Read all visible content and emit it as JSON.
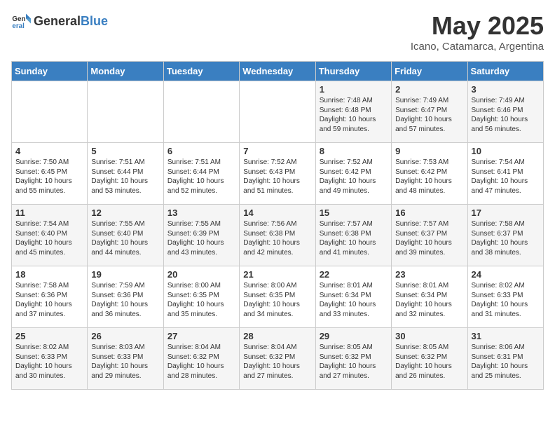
{
  "header": {
    "logo_general": "General",
    "logo_blue": "Blue",
    "month_title": "May 2025",
    "subtitle": "Icano, Catamarca, Argentina"
  },
  "days_of_week": [
    "Sunday",
    "Monday",
    "Tuesday",
    "Wednesday",
    "Thursday",
    "Friday",
    "Saturday"
  ],
  "weeks": [
    [
      {
        "day": "",
        "info": ""
      },
      {
        "day": "",
        "info": ""
      },
      {
        "day": "",
        "info": ""
      },
      {
        "day": "",
        "info": ""
      },
      {
        "day": "1",
        "info": "Sunrise: 7:48 AM\nSunset: 6:48 PM\nDaylight: 10 hours\nand 59 minutes."
      },
      {
        "day": "2",
        "info": "Sunrise: 7:49 AM\nSunset: 6:47 PM\nDaylight: 10 hours\nand 57 minutes."
      },
      {
        "day": "3",
        "info": "Sunrise: 7:49 AM\nSunset: 6:46 PM\nDaylight: 10 hours\nand 56 minutes."
      }
    ],
    [
      {
        "day": "4",
        "info": "Sunrise: 7:50 AM\nSunset: 6:45 PM\nDaylight: 10 hours\nand 55 minutes."
      },
      {
        "day": "5",
        "info": "Sunrise: 7:51 AM\nSunset: 6:44 PM\nDaylight: 10 hours\nand 53 minutes."
      },
      {
        "day": "6",
        "info": "Sunrise: 7:51 AM\nSunset: 6:44 PM\nDaylight: 10 hours\nand 52 minutes."
      },
      {
        "day": "7",
        "info": "Sunrise: 7:52 AM\nSunset: 6:43 PM\nDaylight: 10 hours\nand 51 minutes."
      },
      {
        "day": "8",
        "info": "Sunrise: 7:52 AM\nSunset: 6:42 PM\nDaylight: 10 hours\nand 49 minutes."
      },
      {
        "day": "9",
        "info": "Sunrise: 7:53 AM\nSunset: 6:42 PM\nDaylight: 10 hours\nand 48 minutes."
      },
      {
        "day": "10",
        "info": "Sunrise: 7:54 AM\nSunset: 6:41 PM\nDaylight: 10 hours\nand 47 minutes."
      }
    ],
    [
      {
        "day": "11",
        "info": "Sunrise: 7:54 AM\nSunset: 6:40 PM\nDaylight: 10 hours\nand 45 minutes."
      },
      {
        "day": "12",
        "info": "Sunrise: 7:55 AM\nSunset: 6:40 PM\nDaylight: 10 hours\nand 44 minutes."
      },
      {
        "day": "13",
        "info": "Sunrise: 7:55 AM\nSunset: 6:39 PM\nDaylight: 10 hours\nand 43 minutes."
      },
      {
        "day": "14",
        "info": "Sunrise: 7:56 AM\nSunset: 6:38 PM\nDaylight: 10 hours\nand 42 minutes."
      },
      {
        "day": "15",
        "info": "Sunrise: 7:57 AM\nSunset: 6:38 PM\nDaylight: 10 hours\nand 41 minutes."
      },
      {
        "day": "16",
        "info": "Sunrise: 7:57 AM\nSunset: 6:37 PM\nDaylight: 10 hours\nand 39 minutes."
      },
      {
        "day": "17",
        "info": "Sunrise: 7:58 AM\nSunset: 6:37 PM\nDaylight: 10 hours\nand 38 minutes."
      }
    ],
    [
      {
        "day": "18",
        "info": "Sunrise: 7:58 AM\nSunset: 6:36 PM\nDaylight: 10 hours\nand 37 minutes."
      },
      {
        "day": "19",
        "info": "Sunrise: 7:59 AM\nSunset: 6:36 PM\nDaylight: 10 hours\nand 36 minutes."
      },
      {
        "day": "20",
        "info": "Sunrise: 8:00 AM\nSunset: 6:35 PM\nDaylight: 10 hours\nand 35 minutes."
      },
      {
        "day": "21",
        "info": "Sunrise: 8:00 AM\nSunset: 6:35 PM\nDaylight: 10 hours\nand 34 minutes."
      },
      {
        "day": "22",
        "info": "Sunrise: 8:01 AM\nSunset: 6:34 PM\nDaylight: 10 hours\nand 33 minutes."
      },
      {
        "day": "23",
        "info": "Sunrise: 8:01 AM\nSunset: 6:34 PM\nDaylight: 10 hours\nand 32 minutes."
      },
      {
        "day": "24",
        "info": "Sunrise: 8:02 AM\nSunset: 6:33 PM\nDaylight: 10 hours\nand 31 minutes."
      }
    ],
    [
      {
        "day": "25",
        "info": "Sunrise: 8:02 AM\nSunset: 6:33 PM\nDaylight: 10 hours\nand 30 minutes."
      },
      {
        "day": "26",
        "info": "Sunrise: 8:03 AM\nSunset: 6:33 PM\nDaylight: 10 hours\nand 29 minutes."
      },
      {
        "day": "27",
        "info": "Sunrise: 8:04 AM\nSunset: 6:32 PM\nDaylight: 10 hours\nand 28 minutes."
      },
      {
        "day": "28",
        "info": "Sunrise: 8:04 AM\nSunset: 6:32 PM\nDaylight: 10 hours\nand 27 minutes."
      },
      {
        "day": "29",
        "info": "Sunrise: 8:05 AM\nSunset: 6:32 PM\nDaylight: 10 hours\nand 27 minutes."
      },
      {
        "day": "30",
        "info": "Sunrise: 8:05 AM\nSunset: 6:32 PM\nDaylight: 10 hours\nand 26 minutes."
      },
      {
        "day": "31",
        "info": "Sunrise: 8:06 AM\nSunset: 6:31 PM\nDaylight: 10 hours\nand 25 minutes."
      }
    ]
  ]
}
